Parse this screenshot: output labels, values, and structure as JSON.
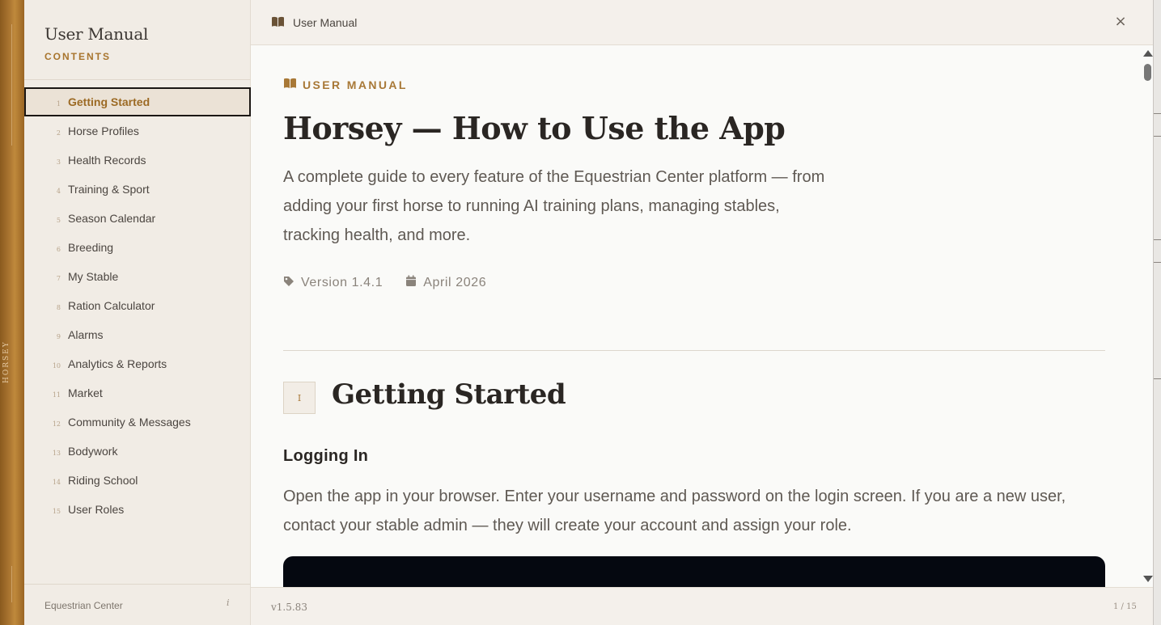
{
  "spine": {
    "brand": "HORSEY"
  },
  "sidebar": {
    "title": "User Manual",
    "subtitle": "CONTENTS",
    "items": [
      {
        "num": "1",
        "label": "Getting Started",
        "active": true
      },
      {
        "num": "2",
        "label": "Horse Profiles"
      },
      {
        "num": "3",
        "label": "Health Records"
      },
      {
        "num": "4",
        "label": "Training & Sport"
      },
      {
        "num": "5",
        "label": "Season Calendar"
      },
      {
        "num": "6",
        "label": "Breeding"
      },
      {
        "num": "7",
        "label": "My Stable"
      },
      {
        "num": "8",
        "label": "Ration Calculator"
      },
      {
        "num": "9",
        "label": "Alarms"
      },
      {
        "num": "10",
        "label": "Analytics & Reports"
      },
      {
        "num": "11",
        "label": "Market"
      },
      {
        "num": "12",
        "label": "Community & Messages"
      },
      {
        "num": "13",
        "label": "Bodywork"
      },
      {
        "num": "14",
        "label": "Riding School"
      },
      {
        "num": "15",
        "label": "User Roles"
      }
    ],
    "footer": {
      "label": "Equestrian Center",
      "icon_text": "i"
    }
  },
  "topbar": {
    "title": "User Manual",
    "close_symbol": "×"
  },
  "doc": {
    "eyebrow": "USER MANUAL",
    "title": "Horsey — How to Use the App",
    "lead": "A complete guide to every feature of the Equestrian Center platform — from adding your first horse to running AI training plans, managing stables, tracking health, and more.",
    "version": "Version 1.4.1",
    "date": "April 2026",
    "section": {
      "numeral": "I",
      "title": "Getting Started",
      "subtitle": "Logging In",
      "paragraph": "Open the app in your browser. Enter your username and password on the login screen. If you are a new user, contact your stable admin — they will create your account and assign your role."
    }
  },
  "footer": {
    "version": "v1.5.83",
    "pager": "1 / 15"
  },
  "icons": {
    "book": "book-icon",
    "tag": "tag-icon",
    "calendar": "calendar-icon",
    "close": "close-icon"
  },
  "colors": {
    "accent": "#a87836",
    "spine": "#b07a34",
    "ink": "#2a2623",
    "sidebar_bg": "#f1ece5"
  }
}
